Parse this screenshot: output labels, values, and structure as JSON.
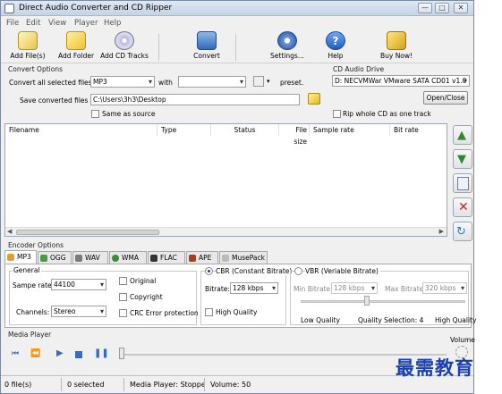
{
  "window": {
    "title": "Direct Audio Converter and CD Ripper",
    "controls": [
      "—",
      "□",
      "✕"
    ]
  },
  "menu": [
    "File",
    "Edit",
    "View",
    "Player",
    "Help"
  ],
  "toolbar": {
    "add_files": "Add File(s)",
    "add_folder": "Add Folder",
    "add_cd": "Add CD Tracks",
    "convert": "Convert",
    "settings": "Settings...",
    "help": "Help",
    "buy": "Buy Now!"
  },
  "convert_options": {
    "group_label": "Convert Options",
    "convert_all_label": "Convert all selected files to",
    "format_value": "MP3",
    "with_label": "with",
    "preset_value": "",
    "preset_label": "preset.",
    "save_label": "Save converted files to",
    "save_path": "C:\\Users\\3h3\\Desktop",
    "same_as_source": "Same as source"
  },
  "cd_drive": {
    "group_label": "CD Audio Drive",
    "drive_value": "D: NECVMWar VMware SATA CD01 v1.0",
    "open_close": "Open/Close",
    "rip_whole": "Rip whole CD as one track"
  },
  "file_list": {
    "columns": [
      "Filename",
      "Type",
      "Status",
      "File size",
      "Sample rate",
      "Bit rate"
    ],
    "rows": []
  },
  "encoder": {
    "group_label": "Encoder Options",
    "tabs": [
      "MP3",
      "OGG",
      "WAV",
      "WMA",
      "FLAC",
      "APE",
      "MusePack"
    ],
    "general_label": "General",
    "sample_rate_label": "Sampe rate:",
    "sample_rate_value": "44100",
    "channels_label": "Channels:",
    "channels_value": "Stereo",
    "original": "Original",
    "copyright": "Copyright",
    "crc": "CRC Error protection",
    "cbr_label": "CBR (Constant Bitrate)",
    "bitrate_label": "Bitrate:",
    "bitrate_value": "128 kbps",
    "high_quality_cbr": "High Quality",
    "vbr_label": "VBR (Veriable Bitrate)",
    "min_bitrate_label": "Min Bitrate:",
    "min_bitrate_value": "128 kbps",
    "max_bitrate_label": "Max Bitrate:",
    "max_bitrate_value": "320 kbps",
    "low_quality": "Low Quality",
    "quality_selection": "Quality Selection: 4",
    "high_quality_vbr": "High Quality",
    "quality_level": 0.4
  },
  "media_player": {
    "label": "Media Player",
    "volume_label": "Volume",
    "position": 0
  },
  "status": {
    "files": "0 file(s)",
    "selected": "0 selected",
    "player": "Media Player: Stopped",
    "volume": "Volume: 50"
  },
  "watermark": {
    "text": "最需教育"
  },
  "colors": {
    "accent": "#1f4e8f",
    "titlebar": "#c4d3e6",
    "watermark": "#1a3fb0"
  }
}
